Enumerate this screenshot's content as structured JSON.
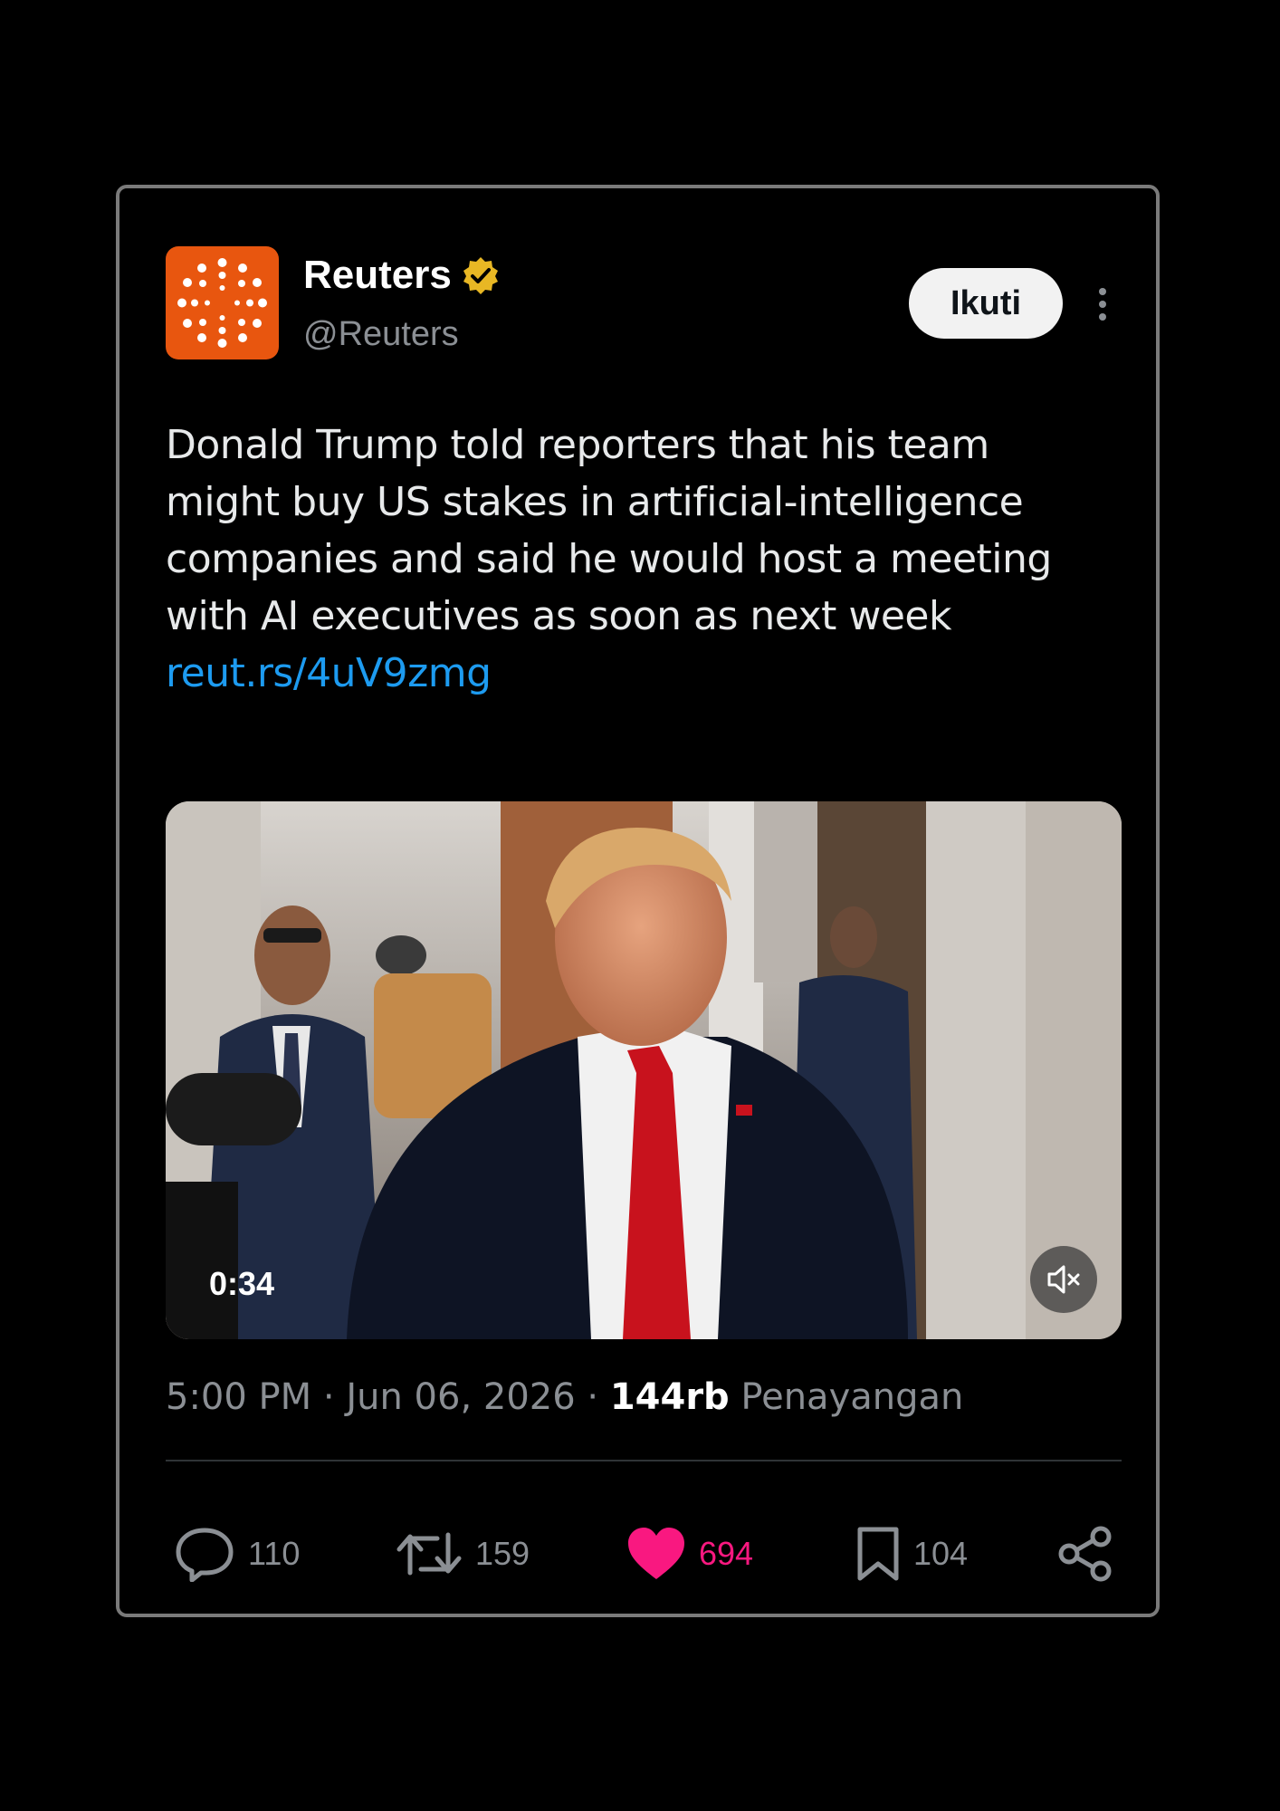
{
  "account": {
    "name": "Reuters",
    "handle": "@Reuters",
    "avatar_color": "#e8560f",
    "verified_badge_color": "#e8b724"
  },
  "follow_button": {
    "label": "Ikuti"
  },
  "tweet": {
    "text": "Donald Trump told reporters that his team might buy US stakes in artificial-intelligence companies and said he would host a meeting with AI executives as soon as next week ",
    "link": "reut.rs/4uV9zmg"
  },
  "media": {
    "duration": "0:34",
    "muted": true
  },
  "meta": {
    "time": "5:00 PM",
    "separator": " · ",
    "date": "Jun 06, 2026",
    "views_count": "144rb",
    "views_label": " Penayangan"
  },
  "actions": {
    "replies": "110",
    "reposts": "159",
    "likes": "694",
    "bookmarks": "104",
    "like_color": "#f91880",
    "link_color": "#1d9bf0"
  }
}
